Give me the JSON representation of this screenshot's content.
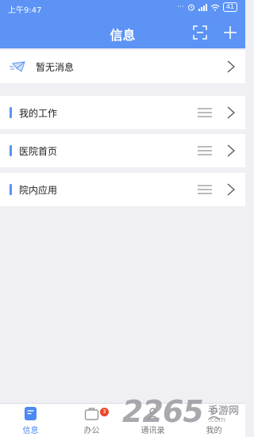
{
  "status": {
    "time": "上午9:47",
    "battery": "41"
  },
  "header": {
    "title": "信息"
  },
  "message_row": {
    "label": "暂无消息"
  },
  "sections": [
    {
      "label": "我的工作"
    },
    {
      "label": "医院首页"
    },
    {
      "label": "院内应用"
    }
  ],
  "tabs": [
    {
      "label": "信息"
    },
    {
      "label": "办公",
      "badge": "3"
    },
    {
      "label": "通讯录"
    },
    {
      "label": "我的"
    }
  ],
  "watermark": {
    "brand": "2265",
    "text": "手游网",
    "url": ".com"
  },
  "colors": {
    "accent": "#5c93f5",
    "badge": "#e9472b",
    "background": "#efeff4"
  }
}
